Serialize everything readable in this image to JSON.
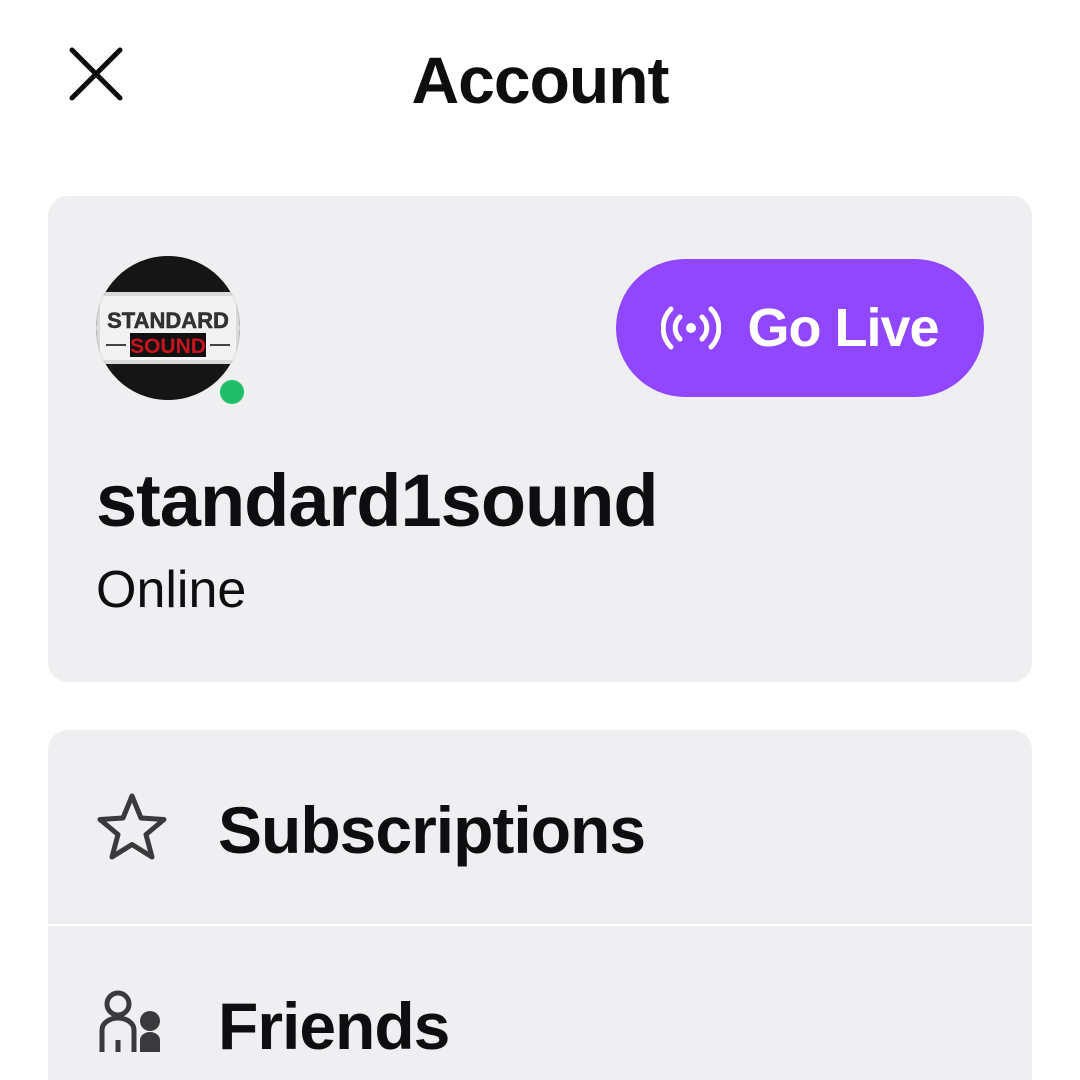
{
  "header": {
    "title": "Account",
    "close_icon": "close-icon"
  },
  "profile": {
    "avatar_text_top": "STANDARD",
    "avatar_text_bottom": "SOUND",
    "username": "standard1sound",
    "status": "Online",
    "status_color": "#1fbd69",
    "go_live_label": "Go Live",
    "go_live_icon": "broadcast-icon",
    "accent_color": "#9147ff"
  },
  "menu": {
    "items": [
      {
        "label": "Subscriptions",
        "icon": "star-icon"
      },
      {
        "label": "Friends",
        "icon": "friends-icon"
      }
    ]
  }
}
